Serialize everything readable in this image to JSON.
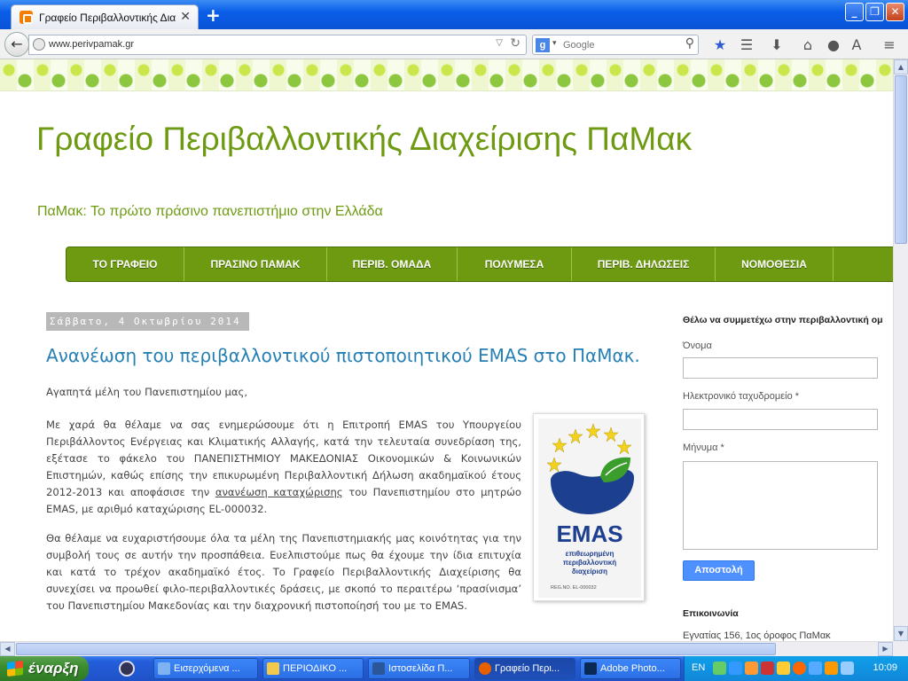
{
  "browser": {
    "tab_title": "Γραφείο Περιβαλλοντικής Δια",
    "url": "www.perivpamak.gr",
    "search_placeholder": "Google"
  },
  "blog": {
    "title": "Γραφείο Περιβαλλοντικής Διαχείρισης ΠαΜακ",
    "description": "ΠαΜακ: Το πρώτο πράσινο πανεπιστήμιο στην Ελλάδα"
  },
  "menu": [
    {
      "label": "ΤΟ ΓΡΑΦΕΙΟ"
    },
    {
      "label": "ΠΡΑΣΙΝΟ ΠΑΜΑΚ"
    },
    {
      "label": "ΠΕΡΙΒ. ΟΜΑΔΑ"
    },
    {
      "label": "ΠΟΛΥΜΕΣΑ"
    },
    {
      "label": "ΠΕΡΙΒ. ΔΗΛΩΣΕΙΣ"
    },
    {
      "label": "ΝΟΜΟΘΕΣΙΑ"
    }
  ],
  "post": {
    "date": "Σάββατο, 4 Οκτωβρίου 2014",
    "title": "Ανανέωση του περιβαλλοντικού πιστοποιητικού EMAS στο ΠαΜακ.",
    "greeting": "Αγαπητά μέλη του Πανεπιστημίου μας,",
    "p1_before_link": "Με χαρά θα θέλαμε να σας ενημερώσουμε ότι η Επιτροπή EMAS του Υπουργείου Περιβάλλοντος Ενέργειας και Κλιματικής Αλλαγής, κατά την τελευταία συνεδρίαση της, εξέτασε το φάκελο του ΠΑΝΕΠΙΣΤΗΜΙΟΥ ΜΑΚΕΔΟΝΙΑΣ Οικονομικών & Κοινωνικών Επιστημών, καθώς επίσης την επικυρωμένη Περιβαλλοντική Δήλωση ακαδημαϊκού έτους 2012-2013 και αποφάσισε την ",
    "p1_link": "ανανέωση καταχώρισης",
    "p1_after_link": " του Πανεπιστημίου στο μητρώο EMAS, με αριθμό καταχώρισης EL-000032.",
    "p2": "Θα θέλαμε να ευχαριστήσουμε όλα τα μέλη της Πανεπιστημιακής μας κοινότητας για την συμβολή τους σε αυτήν την προσπάθεια. Ευελπιστούμε πως θα έχουμε την ίδια επιτυχία και κατά το τρέχον ακαδημαϊκό έτος. Το Γραφείο Περιβαλλοντικής Διαχείρισης θα συνεχίσει να προωθεί φιλο-περιβαλλοντικές δράσεις, με σκοπό το περαιτέρω ‘πρασίνισμα’ του Πανεπιστημίου Μακεδονίας και την διαχρονική πιστοποίησή του με το EMAS."
  },
  "emas_logo": {
    "label": "EMAS",
    "subtitle_1": "επιθεωρημένη",
    "subtitle_2": "περιβαλλοντική",
    "subtitle_3": "διαχείριση",
    "reg": "REG.NO. EL-000032"
  },
  "sidebar": {
    "form_heading": "Θέλω να συμμετέχω στην περιβαλλοντική ομ",
    "name_label": "Όνομα",
    "email_label": "Ηλεκτρονικό ταχυδρομείο *",
    "message_label": "Μήνυμα *",
    "send_label": "Αποστολή",
    "contact_heading": "Επικοινωνία",
    "contact_text": "Εγνατίας 156, 1ος όροφος ΠαΜακ"
  },
  "taskbar": {
    "start_label": "έναρξη",
    "tasks": [
      {
        "label": "Εισερχόμενα ..."
      },
      {
        "label": "ΠΕΡΙΟΔΙΚΟ ..."
      },
      {
        "label": "Ιστοσελίδα Π..."
      },
      {
        "label": "Γραφείο Περι..."
      },
      {
        "label": "Adobe Photo..."
      }
    ],
    "lang": "EN",
    "clock": "10:09"
  },
  "colors": {
    "blog_green": "#6e9a12",
    "post_title_blue": "#2680b5",
    "menu_green": "#6e9a12",
    "send_blue": "#4d90fe"
  }
}
